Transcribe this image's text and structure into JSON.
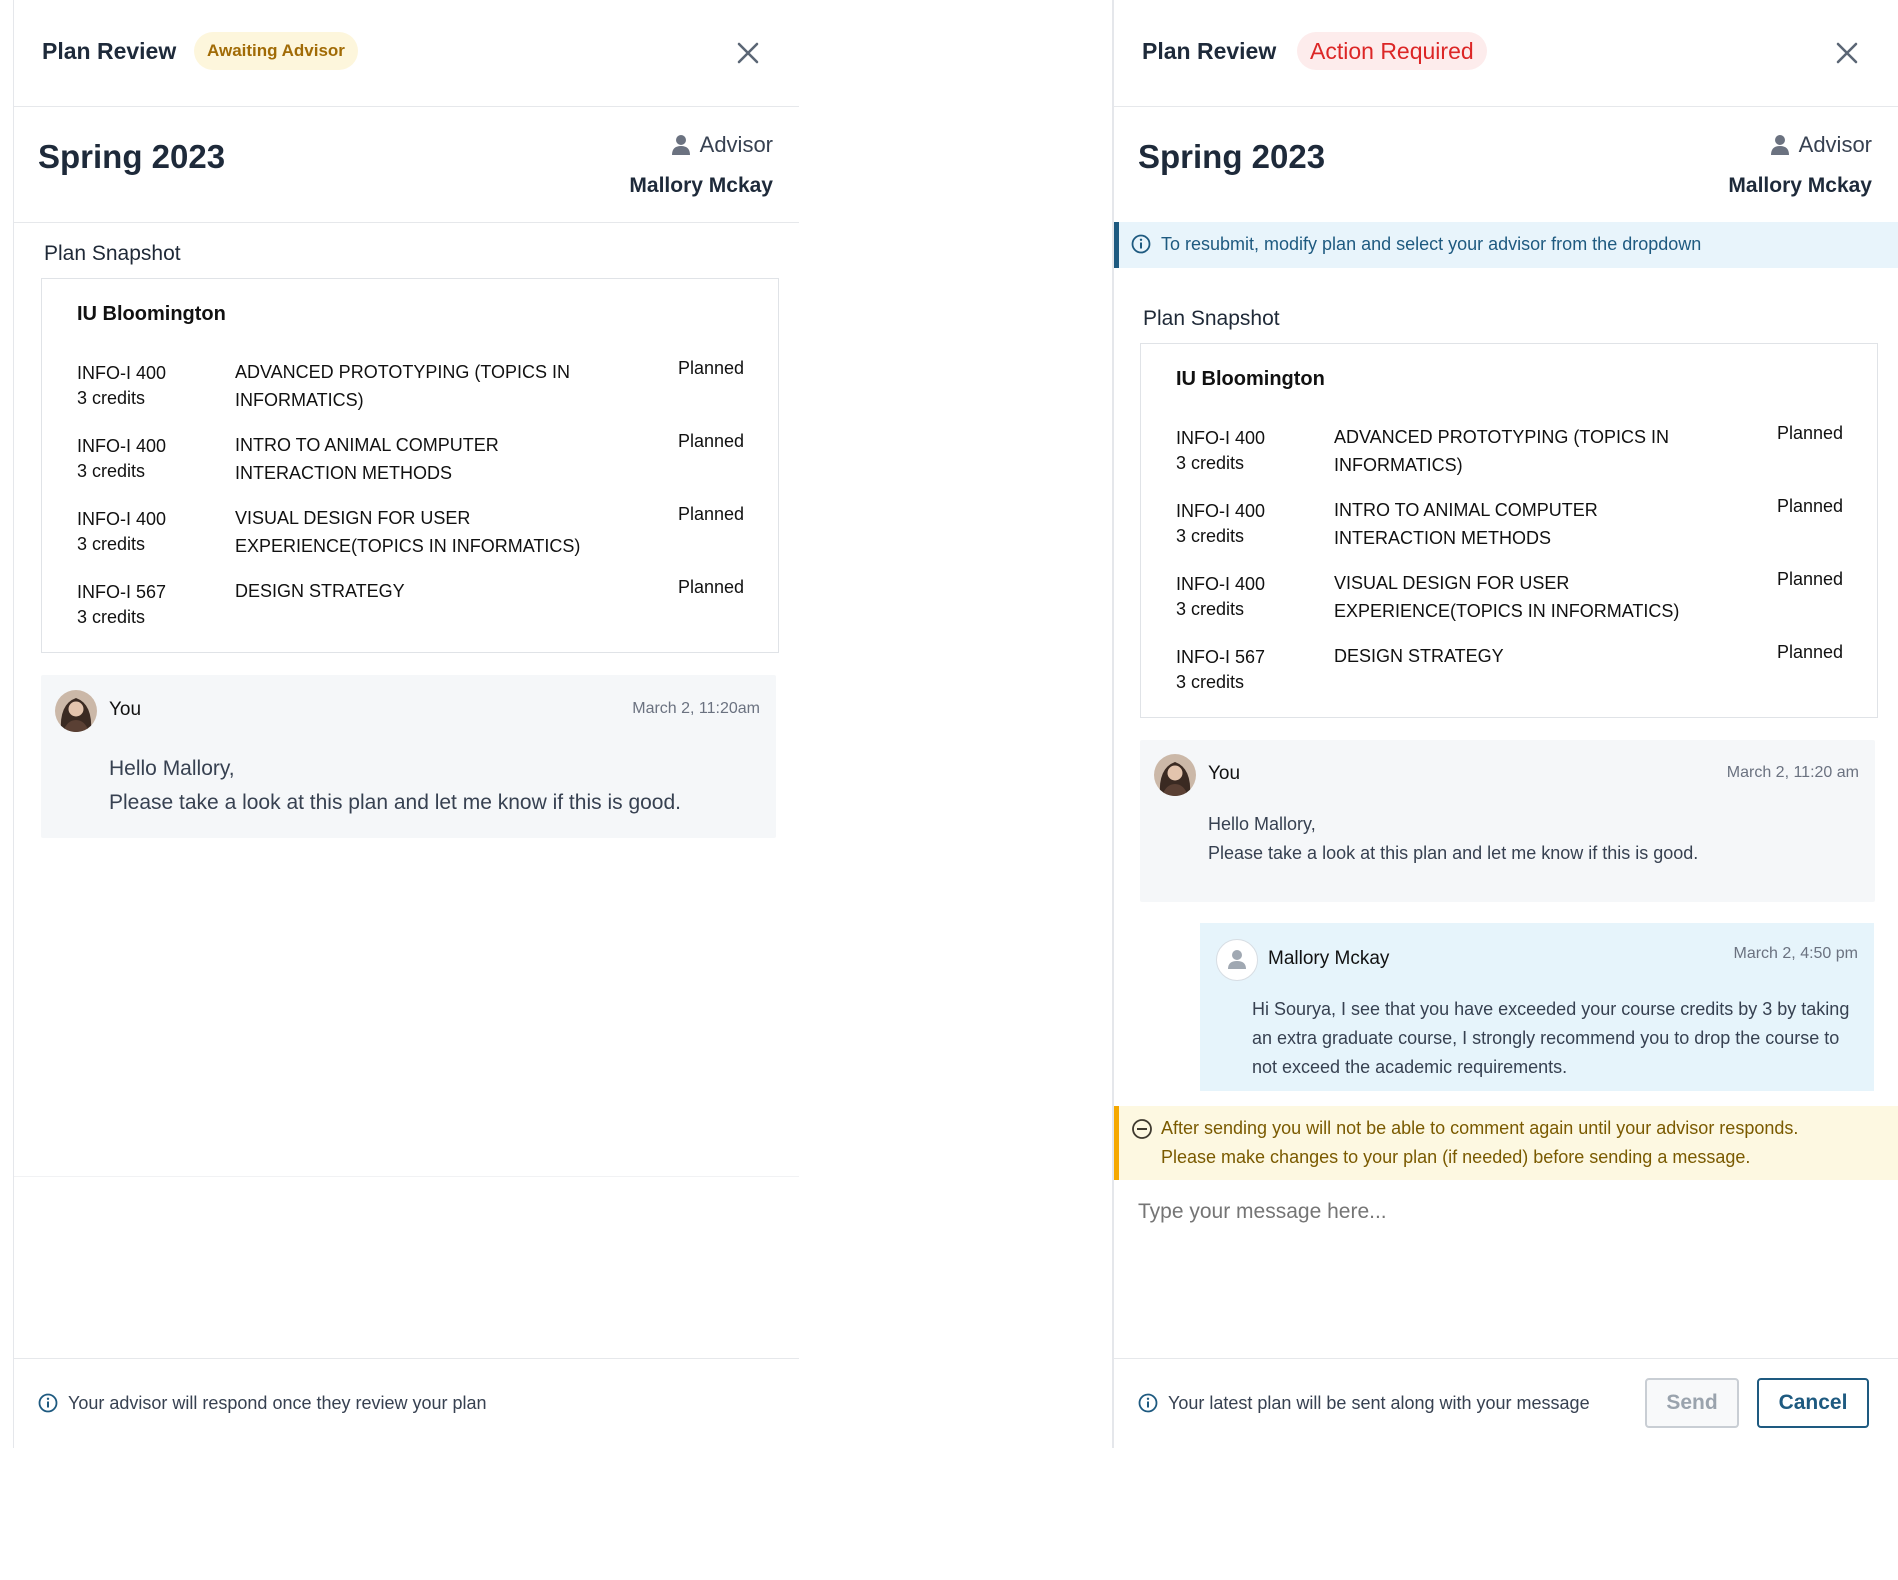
{
  "left_panel": {
    "title": "Plan Review",
    "status_badge": "Awaiting Advisor",
    "term": "Spring 2023",
    "advisor_label": "Advisor",
    "advisor_name": "Mallory Mckay",
    "snapshot_title": "Plan Snapshot",
    "campus": "IU Bloomington",
    "courses": [
      {
        "code": "INFO-I 400",
        "credits": "3 credits",
        "name": "ADVANCED PROTOTYPING (TOPICS IN INFORMATICS)",
        "status": "Planned"
      },
      {
        "code": "INFO-I 400",
        "credits": "3 credits",
        "name": "INTRO TO ANIMAL COMPUTER INTERACTION METHODS",
        "status": "Planned"
      },
      {
        "code": "INFO-I 400",
        "credits": "3 credits",
        "name": "VISUAL DESIGN FOR USER EXPERIENCE(TOPICS IN INFORMATICS)",
        "status": "Planned"
      },
      {
        "code": "INFO-I 567",
        "credits": "3 credits",
        "name": "DESIGN STRATEGY",
        "status": "Planned"
      }
    ],
    "message": {
      "author": "You",
      "timestamp": "March 2, 11:20am",
      "line1": "Hello Mallory,",
      "line2": "Please take a look at this plan and let me know if this is good."
    },
    "footer_note": "Your advisor will respond once they review your plan"
  },
  "right_panel": {
    "title": "Plan Review",
    "status_badge": "Action Required",
    "term": "Spring 2023",
    "advisor_label": "Advisor",
    "advisor_name": "Mallory Mckay",
    "info_alert": "To resubmit, modify plan and select your advisor from the dropdown",
    "snapshot_title": "Plan Snapshot",
    "campus": "IU Bloomington",
    "courses": [
      {
        "code": "INFO-I 400",
        "credits": "3 credits",
        "name": "ADVANCED PROTOTYPING (TOPICS IN INFORMATICS)",
        "status": "Planned"
      },
      {
        "code": "INFO-I 400",
        "credits": "3 credits",
        "name": "INTRO TO ANIMAL COMPUTER INTERACTION METHODS",
        "status": "Planned"
      },
      {
        "code": "INFO-I 400",
        "credits": "3 credits",
        "name": "VISUAL DESIGN FOR USER EXPERIENCE(TOPICS IN INFORMATICS)",
        "status": "Planned"
      },
      {
        "code": "INFO-I 567",
        "credits": "3 credits",
        "name": "DESIGN STRATEGY",
        "status": "Planned"
      }
    ],
    "message_you": {
      "author": "You",
      "timestamp": "March 2, 11:20 am",
      "line1": "Hello Mallory,",
      "line2": "Please take a look at this plan and let me know if this is good."
    },
    "message_advisor": {
      "author": "Mallory Mckay",
      "timestamp": "March 2, 4:50 pm",
      "body": "Hi Sourya, I see that you have exceeded your course credits by 3 by taking an extra graduate course, I strongly recommend you to drop the course to not exceed the academic requirements."
    },
    "warning_line1": "After sending you will not be able to comment again until your advisor responds.",
    "warning_line2": "Please make changes to your plan (if needed) before sending a message.",
    "message_placeholder": "Type your message here...",
    "footer_note": "Your latest plan will be sent along with your message",
    "send_label": "Send",
    "cancel_label": "Cancel"
  },
  "colors": {
    "awaiting_badge_bg": "#fdf6dc",
    "awaiting_badge_text": "#a16b06",
    "action_badge_bg": "#fdecec",
    "action_badge_text": "#dc2626",
    "info_blue": "#1e5a80",
    "warning_border": "#f5a800"
  }
}
